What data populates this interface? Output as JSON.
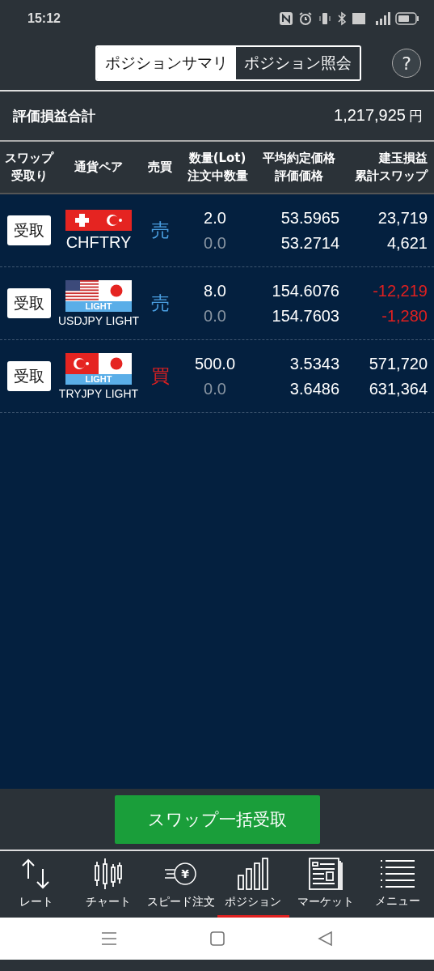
{
  "status_bar": {
    "time": "15:12"
  },
  "tabs": [
    {
      "label": "ポジションサマリ",
      "selected": true
    },
    {
      "label": "ポジション照会",
      "selected": false
    }
  ],
  "help": "?",
  "summary": {
    "label": "評価損益合計",
    "value": "1,217,925",
    "unit": "円"
  },
  "columns": [
    [
      "スワップ",
      "受取り"
    ],
    [
      "通貨ペア"
    ],
    [
      "売買"
    ],
    [
      "数量(Lot)",
      "注文中数量"
    ],
    [
      "平均約定価格",
      "評価価格"
    ],
    [
      "建玉損益",
      "累計スワップ"
    ]
  ],
  "rows": [
    {
      "button": "受取",
      "flags": [
        {
          "kind": "ch"
        },
        {
          "kind": "tr"
        }
      ],
      "pair": "CHFTRY",
      "side": {
        "text": "売",
        "color": "#4a9ee0"
      },
      "qty": "2.0",
      "pending": "0.0",
      "avg_price": "53.5965",
      "eval_price": "53.2714",
      "pl": "23,719",
      "swap": "4,621",
      "loss": false
    },
    {
      "button": "受取",
      "flags": [
        {
          "kind": "us"
        },
        {
          "kind": "jp"
        }
      ],
      "light": "LIGHT",
      "pair": "USDJPY LIGHT",
      "side": {
        "text": "売",
        "color": "#4a9ee0"
      },
      "qty": "8.0",
      "pending": "0.0",
      "avg_price": "154.6076",
      "eval_price": "154.7603",
      "pl": "-12,219",
      "swap": "-1,280",
      "loss": true
    },
    {
      "button": "受取",
      "flags": [
        {
          "kind": "tr"
        },
        {
          "kind": "jp"
        }
      ],
      "light": "LIGHT",
      "pair": "TRYJPY LIGHT",
      "side": {
        "text": "買",
        "color": "#e02020"
      },
      "qty": "500.0",
      "pending": "0.0",
      "avg_price": "3.5343",
      "eval_price": "3.6486",
      "pl": "571,720",
      "swap": "631,364",
      "loss": false
    }
  ],
  "bulk_button": "スワップ一括受取",
  "nav": [
    {
      "kind": "arrows",
      "label": "レート",
      "selected": false
    },
    {
      "kind": "candles",
      "label": "チャート",
      "selected": false
    },
    {
      "kind": "speed",
      "icon_text": "¥",
      "label": "スピード注文",
      "selected": false
    },
    {
      "kind": "bars",
      "label": "ポジション",
      "selected": true
    },
    {
      "kind": "news",
      "label": "マーケット",
      "selected": false
    },
    {
      "kind": "list",
      "label": "メニュー",
      "selected": false
    }
  ]
}
